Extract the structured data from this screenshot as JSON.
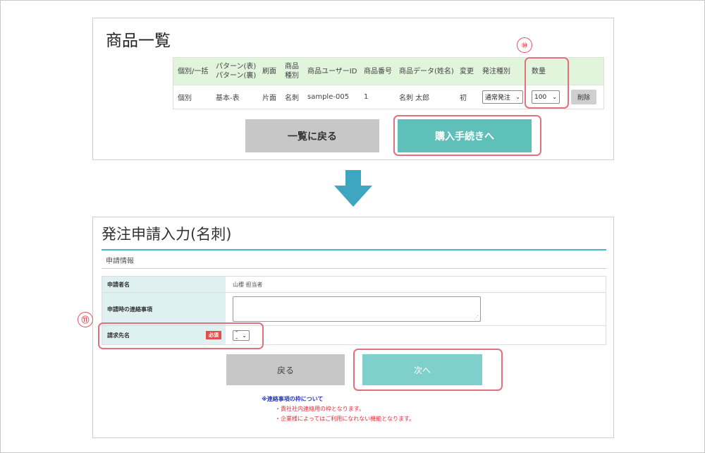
{
  "product_list": {
    "title": "商品一覧",
    "columns": [
      "個別/一括",
      "パターン(表)\nパターン(裏)",
      "刷面",
      "商品\n種別",
      "商品ユーザーID",
      "商品番号",
      "商品データ(姓名)",
      "変更",
      "発注種別",
      "数量",
      ""
    ],
    "row": {
      "kind": "個別",
      "pattern": "基本-表",
      "side": "片面",
      "product_type": "名刺",
      "user_id": "sample-005",
      "product_no": "1",
      "product_data": "名刺 太郎",
      "change": "初",
      "order_type": "通常発注",
      "quantity": "100",
      "delete_label": "削除"
    },
    "back_button": "一覧に戻る",
    "purchase_button": "購入手続きへ",
    "marker": "⑩"
  },
  "order_form": {
    "title": "発注申請入力(名刺)",
    "section": "申請情報",
    "applicant_label": "申請者名",
    "applicant_value": "山櫻 担当者",
    "contact_label": "申請時の連絡事項",
    "billing_label": "請求先名",
    "required_badge": "必須",
    "billing_value": "--",
    "back_button": "戻る",
    "next_button": "次へ",
    "marker": "⑪",
    "note_title": "※連絡事項の枠について",
    "note_lines": [
      "・責社社内連絡用の枠となります。",
      "・企業様によってはご利用になれない機能となります。"
    ]
  },
  "colors": {
    "accent_teal": "#5fbfb9",
    "highlight": "#e3707e",
    "header_green": "#e1f4dc",
    "label_blue": "#dff0f1"
  }
}
